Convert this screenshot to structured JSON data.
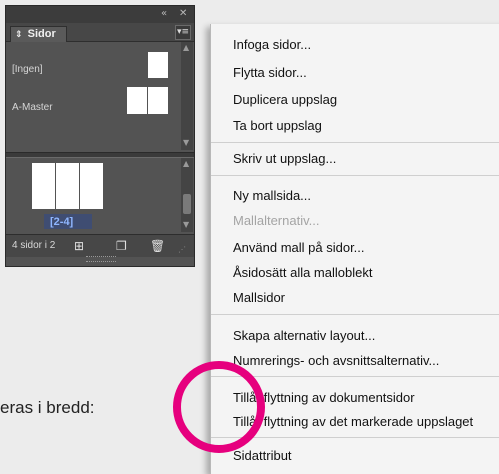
{
  "panel": {
    "title": "Sidor",
    "masters": [
      {
        "label": "[Ingen]"
      },
      {
        "label": "A-Master"
      }
    ],
    "spread_label": "[2-4]",
    "footer": {
      "page_count": "4 sidor i 2"
    }
  },
  "menu": {
    "items": [
      {
        "label": "Infoga sidor...",
        "disabled": false
      },
      {
        "label": "Flytta sidor...",
        "disabled": false
      },
      {
        "label": "Duplicera uppslag",
        "disabled": false
      },
      {
        "label": "Ta bort uppslag",
        "disabled": false
      },
      {
        "label": "Skriv ut uppslag...",
        "disabled": false
      },
      {
        "label": "Ny mallsida...",
        "disabled": false
      },
      {
        "label": "Mallalternativ...",
        "disabled": true
      },
      {
        "label": "Använd mall på sidor...",
        "disabled": false
      },
      {
        "label": "Åsidosätt alla malloblekt",
        "disabled": false
      },
      {
        "label": "Mallsidor",
        "disabled": false
      },
      {
        "label": "Skapa alternativ layout...",
        "disabled": false
      },
      {
        "label": "Numrerings- och avsnittsalternativ...",
        "disabled": false
      },
      {
        "label": "Tillåt flyttning av dokumentsidor",
        "disabled": false
      },
      {
        "label": "Tillåt flyttning av det markerade uppslaget",
        "disabled": false
      },
      {
        "label": "Sidattribut",
        "disabled": false
      }
    ]
  },
  "body_text": "eras i bredd:",
  "colors": {
    "highlight_circle": "#e6007e",
    "menu_bg": "#f4f4f4",
    "panel_bg": "#535353"
  }
}
